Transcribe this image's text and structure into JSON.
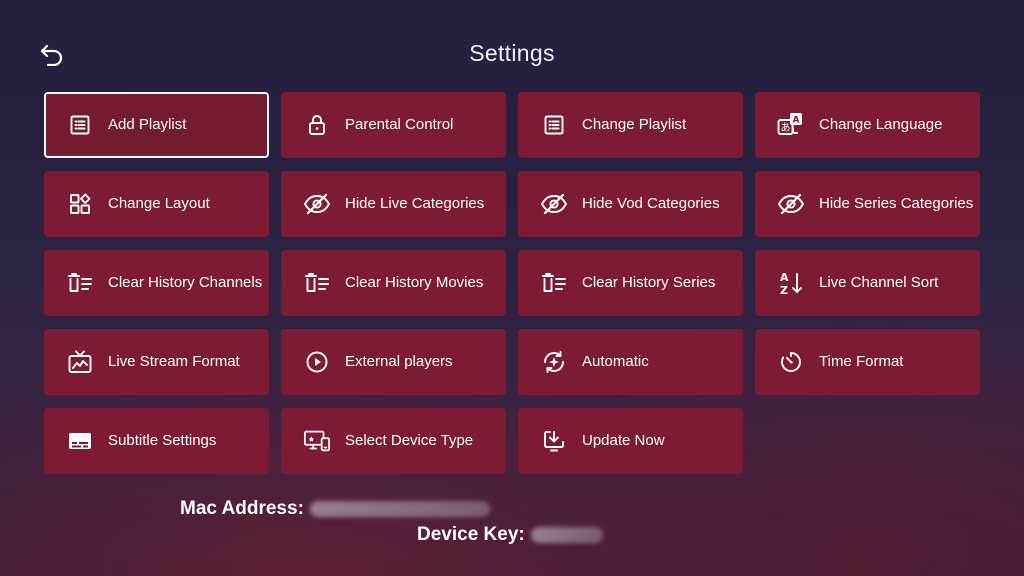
{
  "header": {
    "title": "Settings",
    "back_icon": "back-arrow-icon"
  },
  "tiles": [
    {
      "id": "add-playlist",
      "label": "Add Playlist",
      "icon": "list-icon",
      "selected": true
    },
    {
      "id": "parental-control",
      "label": "Parental Control",
      "icon": "lock-icon"
    },
    {
      "id": "change-playlist",
      "label": "Change Playlist",
      "icon": "list-icon"
    },
    {
      "id": "change-language",
      "label": "Change Language",
      "icon": "translate-icon"
    },
    {
      "id": "change-layout",
      "label": "Change Layout",
      "icon": "layout-icon"
    },
    {
      "id": "hide-live-categories",
      "label": "Hide Live Categories",
      "icon": "eye-off-icon"
    },
    {
      "id": "hide-vod-categories",
      "label": "Hide Vod Categories",
      "icon": "eye-off-icon"
    },
    {
      "id": "hide-series-categories",
      "label": "Hide Series Categories",
      "icon": "eye-off-icon"
    },
    {
      "id": "clear-history-channels",
      "label": "Clear History Channels",
      "icon": "delete-list-icon"
    },
    {
      "id": "clear-history-movies",
      "label": "Clear History Movies",
      "icon": "delete-list-icon"
    },
    {
      "id": "clear-history-series",
      "label": "Clear History Series",
      "icon": "delete-list-icon"
    },
    {
      "id": "live-channel-sort",
      "label": "Live Channel Sort",
      "icon": "sort-az-icon"
    },
    {
      "id": "live-stream-format",
      "label": "Live Stream Format",
      "icon": "tv-icon"
    },
    {
      "id": "external-players",
      "label": "External players",
      "icon": "play-circle-icon"
    },
    {
      "id": "automatic",
      "label": "Automatic",
      "icon": "auto-refresh-icon"
    },
    {
      "id": "time-format",
      "label": "Time Format",
      "icon": "timer-icon"
    },
    {
      "id": "subtitle-settings",
      "label": "Subtitle Settings",
      "icon": "subtitles-icon"
    },
    {
      "id": "select-device-type",
      "label": "Select Device Type",
      "icon": "devices-icon"
    },
    {
      "id": "update-now",
      "label": "Update Now",
      "icon": "download-icon"
    }
  ],
  "device_info": {
    "mac_label": "Mac Address:",
    "key_label": "Device Key:"
  },
  "colors": {
    "tile_bg": "#7c1b33",
    "selected_border": "#ffffff",
    "text": "#ffffff"
  }
}
